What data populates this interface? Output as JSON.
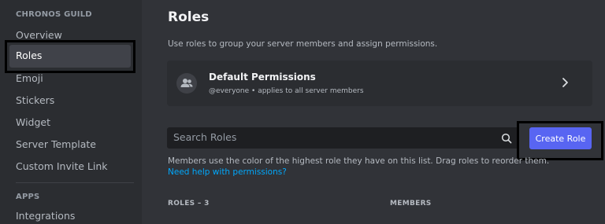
{
  "sidebar": {
    "guild_header": "CHRONOS GUILD",
    "items": [
      {
        "label": "Overview"
      },
      {
        "label": "Roles"
      },
      {
        "label": "Emoji"
      },
      {
        "label": "Stickers"
      },
      {
        "label": "Widget"
      },
      {
        "label": "Server Template"
      },
      {
        "label": "Custom Invite Link"
      }
    ],
    "apps_header": "APPS",
    "apps_items": [
      {
        "label": "Integrations"
      }
    ]
  },
  "main": {
    "title": "Roles",
    "subtitle": "Use roles to group your server members and assign permissions.",
    "default_permissions": {
      "title": "Default Permissions",
      "subtitle": "@everyone • applies to all server members",
      "icon": "members-icon",
      "chevron": "chevron-right-icon"
    },
    "search": {
      "placeholder": "Search Roles",
      "icon": "search-icon"
    },
    "create_role_label": "Create Role",
    "help_text": "Members use the color of the highest role they have on this list. Drag roles to reorder them.",
    "help_link": "Need help with permissions?",
    "columns": {
      "roles": "ROLES – 3",
      "members": "MEMBERS"
    }
  },
  "colors": {
    "accent": "#5865f2",
    "link": "#00a8fc",
    "background": "#313338",
    "sidebar": "#2b2d31"
  }
}
